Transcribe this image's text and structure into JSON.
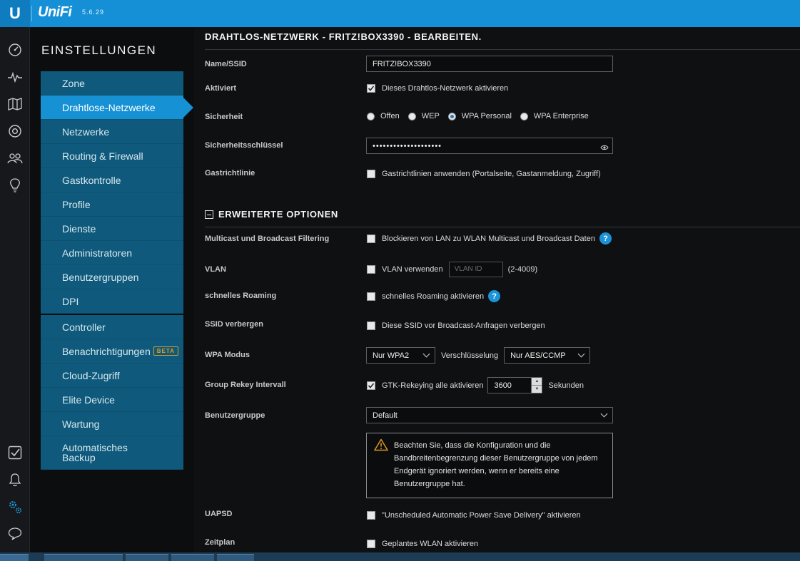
{
  "topbar": {
    "logo_letter": "U",
    "brand": "UniFi",
    "version": "5.6.29"
  },
  "rail": {
    "items": [
      "dashboard-icon",
      "statistics-icon",
      "map-icon",
      "devices-icon",
      "clients-icon",
      "insights-icon",
      "tasks-icon",
      "alerts-icon",
      "settings-icon",
      "chat-icon"
    ]
  },
  "settings": {
    "title": "EINSTELLUNGEN",
    "menu_group1": [
      "Zone",
      "Drahtlose-Netzwerke",
      "Netzwerke",
      "Routing & Firewall",
      "Gastkontrolle",
      "Profile",
      "Dienste",
      "Administratoren",
      "Benutzergruppen",
      "DPI"
    ],
    "menu_group2": [
      "Controller",
      "Benachrichtigungen",
      "Cloud-Zugriff",
      "Elite Device",
      "Wartung",
      "Automatisches Backup"
    ],
    "active": "Drahtlose-Netzwerke",
    "beta_badge": "BETA"
  },
  "form": {
    "page_title": "DRAHTLOS-NETZWERK - FRITZ!BOX3390 - BEARBEITEN.",
    "name_label": "Name/SSID",
    "name_value": "FRITZ!BOX3390",
    "enabled_label": "Aktiviert",
    "enabled_text": "Dieses Drahtlos-Netzwerk aktivieren",
    "enabled_checked": true,
    "security_label": "Sicherheit",
    "security_options": [
      "Offen",
      "WEP",
      "WPA Personal",
      "WPA Enterprise"
    ],
    "security_selected": "WPA Personal",
    "key_label": "Sicherheitsschlüssel",
    "key_value": "••••••••••••••••••••",
    "guest_label": "Gastrichtlinie",
    "guest_text": "Gastrichtlinien anwenden (Portalseite, Gastanmeldung, Zugriff)",
    "advanced_title": "ERWEITERTE OPTIONEN",
    "multicast_label": "Multicast und Broadcast Filtering",
    "multicast_text": "Blockieren von LAN zu WLAN Multicast und Broadcast Daten",
    "vlan_label": "VLAN",
    "vlan_text": "VLAN verwenden",
    "vlan_placeholder": "VLAN ID",
    "vlan_range": "(2-4009)",
    "roaming_label": "schnelles Roaming",
    "roaming_text": "schnelles Roaming aktivieren",
    "hide_ssid_label": "SSID verbergen",
    "hide_ssid_text": "Diese SSID vor Broadcast-Anfragen verbergen",
    "wpa_mode_label": "WPA Modus",
    "wpa_mode_value": "Nur WPA2",
    "encryption_label": "Verschlüsselung",
    "encryption_value": "Nur AES/CCMP",
    "rekey_label": "Group Rekey Intervall",
    "rekey_text": "GTK-Rekeying alle aktivieren",
    "rekey_checked": true,
    "rekey_value": "3600",
    "rekey_unit": "Sekunden",
    "usergroup_label": "Benutzergruppe",
    "usergroup_value": "Default",
    "warning_text": "Beachten Sie, dass die Konfiguration und die Bandbreitenbegrenzung dieser Benutzergruppe von jedem Endgerät ignoriert werden, wenn er bereits eine Benutzergruppe hat.",
    "uapsd_label": "UAPSD",
    "uapsd_text": "\"Unscheduled Automatic Power Save Delivery\" aktivieren",
    "schedule_label": "Zeitplan",
    "schedule_text": "Geplantes WLAN aktivieren",
    "help_glyph": "?"
  },
  "colors": {
    "accent": "#1591d4",
    "menu_bg": "#0f5a7c",
    "topbar": "#1590d6",
    "warning": "#e09a1e"
  }
}
